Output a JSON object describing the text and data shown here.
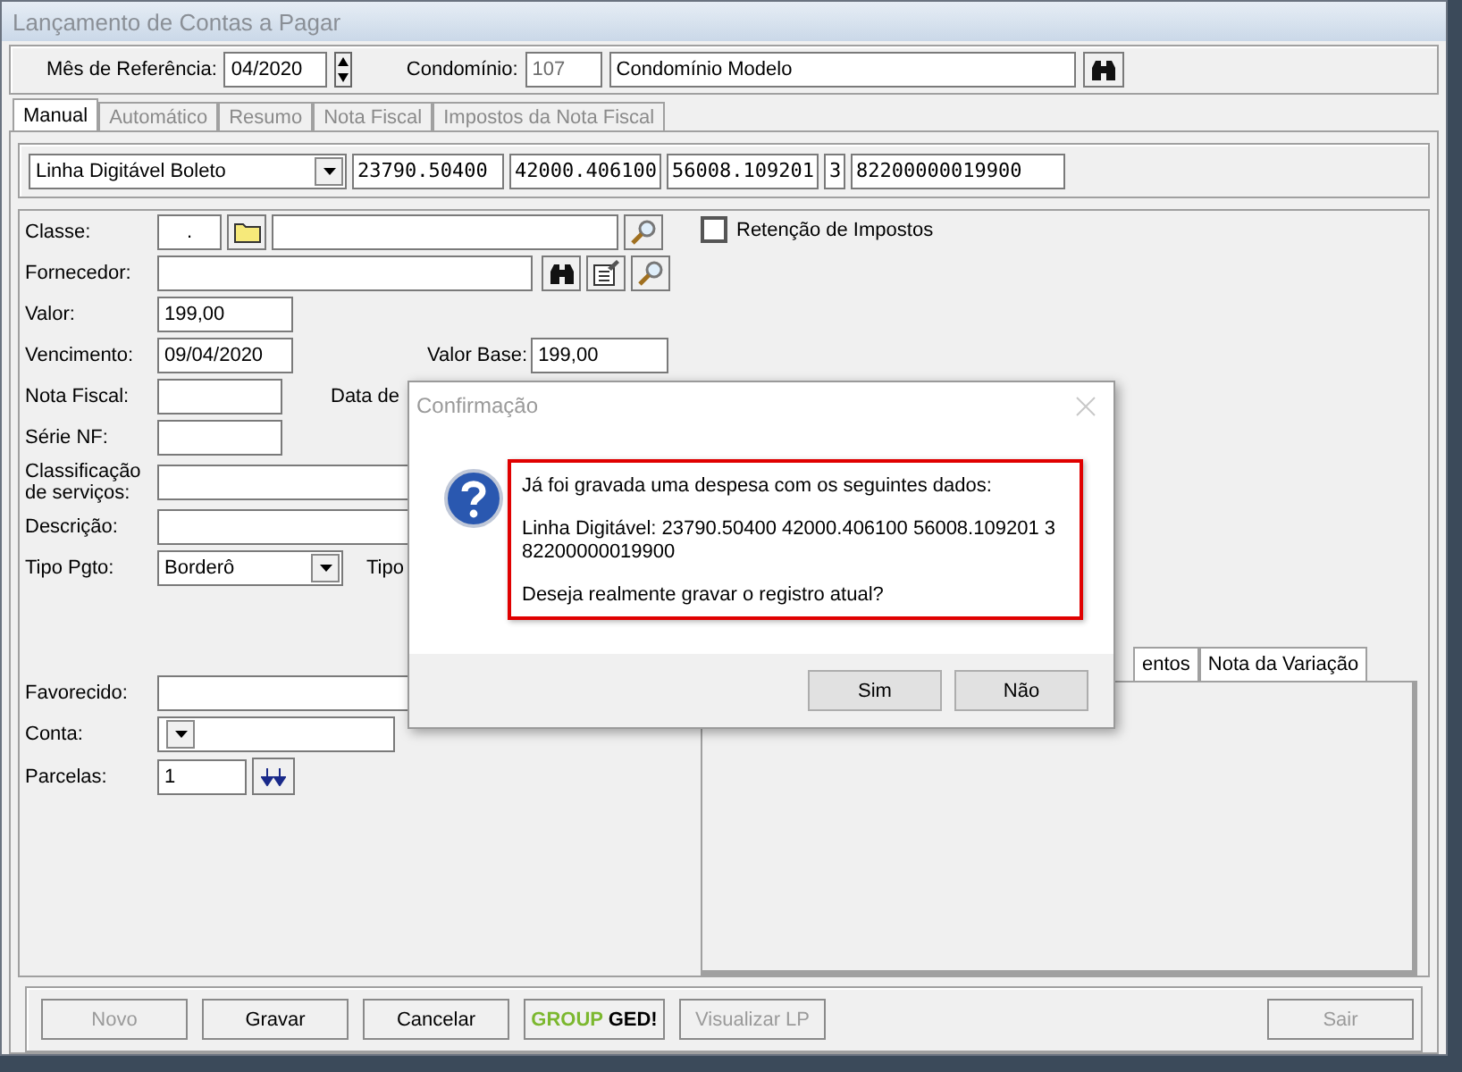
{
  "window": {
    "title": "Lançamento de Contas a Pagar"
  },
  "header": {
    "month_label": "Mês de Referência:",
    "month": "04/2020",
    "condo_label": "Condomínio:",
    "condo_code": {
      "value": "107",
      "disabled": true
    },
    "condo_name": "Condomínio Modelo"
  },
  "tabs": [
    {
      "label": "Manual",
      "selected": true
    },
    {
      "label": "Automático",
      "selected": false
    },
    {
      "label": "Resumo",
      "selected": false
    },
    {
      "label": "Nota Fiscal",
      "selected": false
    },
    {
      "label": "Impostos da Nota Fiscal",
      "selected": false
    }
  ],
  "barcode": {
    "type": "Linha Digitável Boleto",
    "fields": [
      "23790.50400",
      "42000.406100",
      "56008.109201",
      "3",
      "82200000019900"
    ]
  },
  "form": {
    "upper": [
      {
        "kind": "lookup",
        "label": "Classe:",
        "value": "."
      },
      {
        "kind": "supplier",
        "label": "Fornecedor:"
      },
      {
        "kind": "text",
        "label": "Valor:",
        "value": "199,00"
      },
      {
        "kind": "text",
        "label": "Vencimento:",
        "value": "09/04/2020",
        "aside": {
          "label": "Valor Base:",
          "value": "199,00"
        }
      },
      {
        "kind": "short",
        "label": "Nota Fiscal:",
        "aside": {
          "label": "Data de"
        }
      },
      {
        "kind": "short",
        "label": "Série NF:"
      },
      {
        "kind": "wide",
        "label": "Classificação de serviços:"
      },
      {
        "kind": "wide",
        "label": "Descrição:"
      },
      {
        "kind": "select",
        "label": "Tipo Pgto:",
        "value": "Borderô",
        "aside": {
          "label": "Tipo"
        }
      }
    ],
    "lower": [
      {
        "kind": "wide",
        "label": "Favorecido:"
      },
      {
        "kind": "select",
        "label": "Conta:"
      },
      {
        "kind": "parcelas",
        "label": "Parcelas:",
        "value": "1"
      }
    ]
  },
  "tax_retention": {
    "label": "Retenção de Impostos",
    "checked": false
  },
  "detail_tabs": [
    {
      "label": "entos"
    },
    {
      "label": "Nota da Variação"
    }
  ],
  "dialog": {
    "title": "Confirmação",
    "paragraphs": [
      [
        "Já foi gravada uma despesa com os seguintes dados:"
      ],
      [
        "Linha Digitável: 23790.50400 42000.406100 56008.109201 3",
        "82200000019900"
      ],
      [
        "Deseja realmente gravar o registro atual?"
      ]
    ],
    "buttons": [
      "Sim",
      "Não"
    ]
  },
  "buttons": [
    {
      "kind": "text",
      "label": "Novo",
      "disabled": true
    },
    {
      "kind": "text",
      "label": "Gravar",
      "disabled": false
    },
    {
      "kind": "text",
      "label": "Cancelar",
      "disabled": false
    },
    {
      "kind": "logo",
      "parts": [
        "GROUP",
        "GED!"
      ]
    },
    {
      "kind": "text",
      "label": "Visualizar LP",
      "disabled": true
    },
    {
      "kind": "text",
      "label": "Sair",
      "disabled": true
    }
  ]
}
